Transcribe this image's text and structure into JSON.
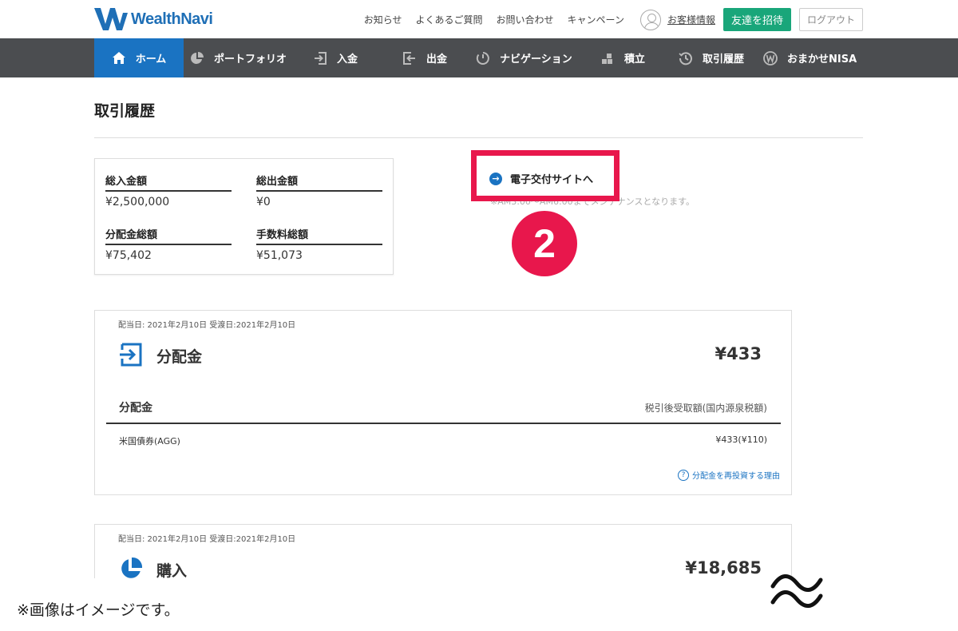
{
  "header": {
    "logo_text": "WealthNavi",
    "links": [
      "お知らせ",
      "よくあるご質問",
      "お問い合わせ",
      "キャンペーン"
    ],
    "account_label": "お客様情報",
    "invite_label": "友達を招待",
    "logout_label": "ログアウト",
    "colors": {
      "brand": "#1f6fb6",
      "invite": "#19a67a"
    }
  },
  "nav": {
    "items": [
      {
        "label": "ホーム",
        "icon": "home-icon",
        "active": true
      },
      {
        "label": "ポートフォリオ",
        "icon": "pie-chart-icon",
        "active": false
      },
      {
        "label": "入金",
        "icon": "deposit-icon",
        "active": false
      },
      {
        "label": "出金",
        "icon": "withdraw-icon",
        "active": false
      },
      {
        "label": "ナビゲーション",
        "icon": "navigation-icon",
        "active": false
      },
      {
        "label": "積立",
        "icon": "stack-icon",
        "active": false
      },
      {
        "label": "取引履歴",
        "icon": "history-icon",
        "active": false
      },
      {
        "label": "おまかせNISA",
        "icon": "nisa-icon",
        "active": false
      }
    ],
    "colors": {
      "background": "#4b4d50",
      "active": "#1a73c2"
    }
  },
  "page": {
    "title": "取引履歴"
  },
  "summary": {
    "total_deposit_label": "総入金額",
    "total_deposit_value": "¥2,500,000",
    "total_withdraw_label": "総出金額",
    "total_withdraw_value": "¥0",
    "total_dividend_label": "分配金総額",
    "total_dividend_value": "¥75,402",
    "total_fee_label": "手数料総額",
    "total_fee_value": "¥51,073"
  },
  "edelivery": {
    "link_label": "電子交付サイトへ",
    "arrow_icon": "arrow-right-circle-icon",
    "maintenance_note": "※AM3:00～AM6:00までメンテナンスとなります。",
    "highlight_color": "#e8174c",
    "step_number": "2"
  },
  "transactions": [
    {
      "date_line": "配当日: 2021年2月10日 受渡日:2021年2月10日",
      "icon": "dividend-in-icon",
      "title": "分配金",
      "amount": "¥433",
      "table_header_left": "分配金",
      "table_header_right": "税引後受取額(国内源泉税額)",
      "row_name": "米国債券(AGG)",
      "row_value": "¥433(¥110)",
      "reason_link": "分配金を再投資する理由"
    },
    {
      "date_line": "配当日: 2021年2月10日 受渡日:2021年2月10日",
      "icon": "purchase-pie-icon",
      "title": "購入",
      "amount": "¥18,685"
    }
  ],
  "footer": {
    "disclaimer": "※画像はイメージです。",
    "approx_icon": "approximately-equal-icon"
  }
}
